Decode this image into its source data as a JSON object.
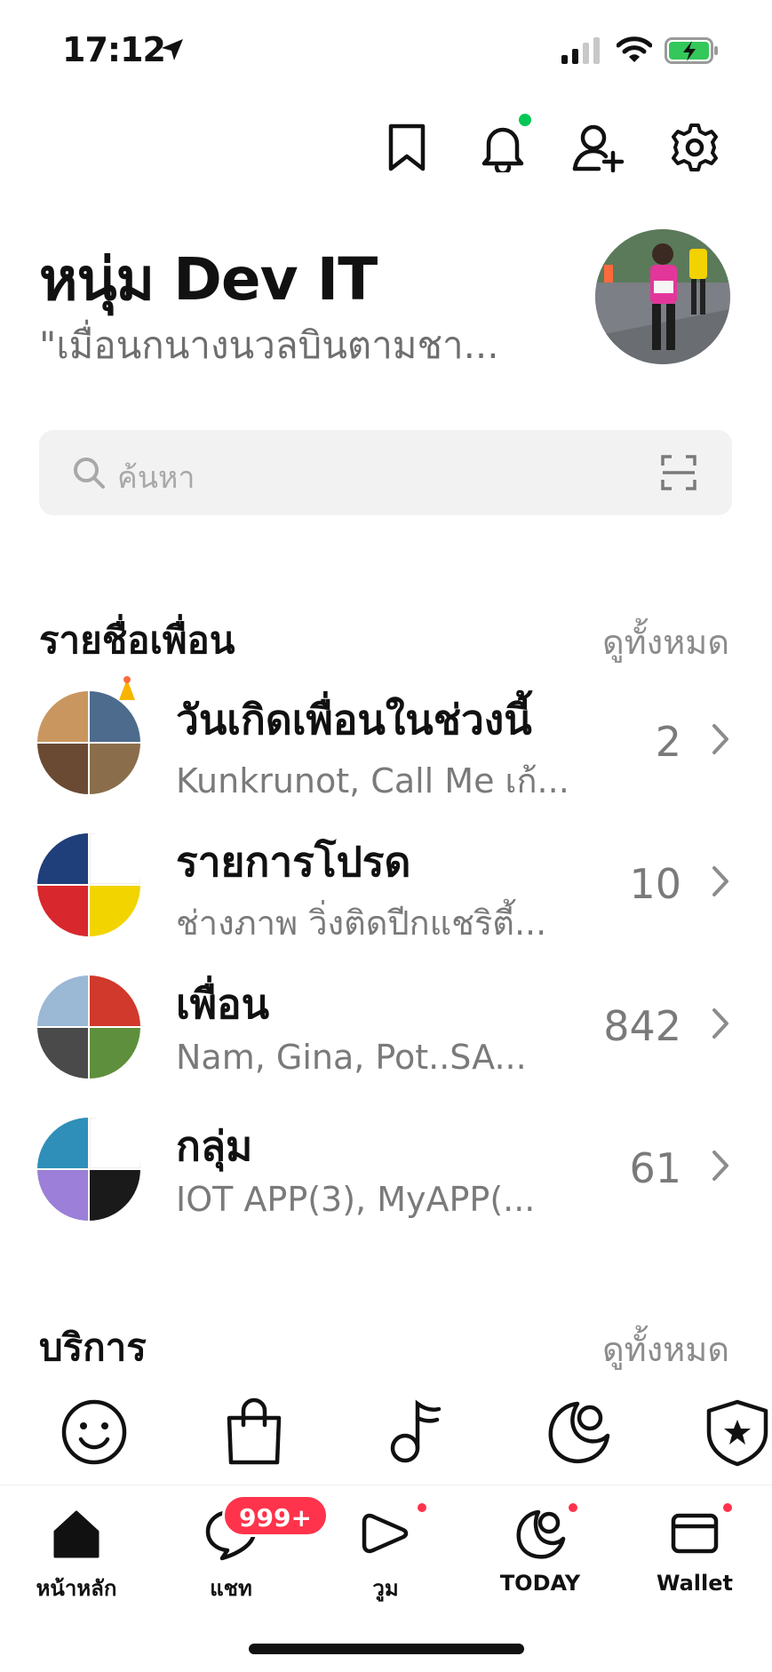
{
  "status_bar": {
    "time": "17:12"
  },
  "top_icons": [
    "bookmark-icon",
    "bell-icon",
    "add-friend-icon",
    "gear-icon"
  ],
  "profile": {
    "name": "หนุ่ม Dev IT",
    "status_message": "\"เมื่อนกนางนวลบินตามชา..."
  },
  "search": {
    "placeholder": "ค้นหา"
  },
  "friends_section": {
    "title": "รายชื่อเพื่อน",
    "see_all": "ดูทั้งหมด",
    "rows": [
      {
        "title": "วันเกิดเพื่อนในช่วงนี้",
        "subtitle": "Kunkrunot, Call Me เก้...",
        "count": "2"
      },
      {
        "title": "รายการโปรด",
        "subtitle": "ช่างภาพ วิ่งติดปีกแชริตี้...",
        "count": "10"
      },
      {
        "title": "เพื่อน",
        "subtitle": "Nam, Gina, Pot..SA...",
        "count": "842"
      },
      {
        "title": "กลุ่ม",
        "subtitle": "IOT APP(3), MyAPP(...",
        "count": "61"
      }
    ]
  },
  "services_section": {
    "title": "บริการ",
    "see_all": "ดูทั้งหมด",
    "icons": [
      "sticker-smile-icon",
      "shopping-bag-icon",
      "music-icon",
      "today-moon-icon",
      "shield-star-icon"
    ]
  },
  "bottom_nav": {
    "items": [
      {
        "label": "หน้าหลัก",
        "icon": "home-icon"
      },
      {
        "label": "แชท",
        "icon": "chat-icon"
      },
      {
        "label": "วูม",
        "icon": "voom-play-icon"
      },
      {
        "label": "TODAY",
        "icon": "today-icon"
      },
      {
        "label": "Wallet",
        "icon": "wallet-icon"
      }
    ],
    "chat_badge": "999+"
  },
  "colors": {
    "accent_green": "#06c755",
    "badge_red": "#ff334b",
    "muted_text": "#7a7a7a"
  }
}
